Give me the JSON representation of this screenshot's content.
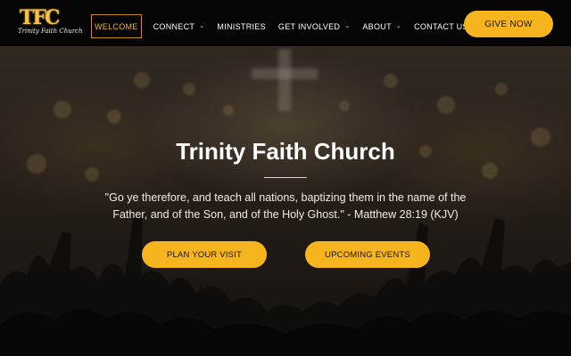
{
  "header": {
    "logo": {
      "mark": "TFC",
      "script": "Trinity Faith Church"
    },
    "nav": [
      {
        "label": "WELCOME",
        "active": true,
        "dropdown": false
      },
      {
        "label": "CONNECT",
        "active": false,
        "dropdown": true
      },
      {
        "label": "MINISTRIES",
        "active": false,
        "dropdown": false
      },
      {
        "label": "GET INVOLVED",
        "active": false,
        "dropdown": true
      },
      {
        "label": "ABOUT",
        "active": false,
        "dropdown": true
      },
      {
        "label": "CONTACT US",
        "active": false,
        "dropdown": false
      }
    ],
    "give_label": "GIVE NOW"
  },
  "hero": {
    "title": "Trinity Faith Church",
    "verse": "\"Go ye therefore, and teach all nations, baptizing them in the name of the Father, and of the Son, and of the Holy Ghost.\" - Matthew 28:19 (KJV)",
    "buttons": {
      "visit": "PLAN YOUR VISIT",
      "events": "UPCOMING EVENTS"
    }
  },
  "colors": {
    "accent": "#f6b51e",
    "header_bg": "#060505",
    "active_border": "#c58d16"
  },
  "icons": {
    "dropdown": "chevron-down-icon"
  }
}
